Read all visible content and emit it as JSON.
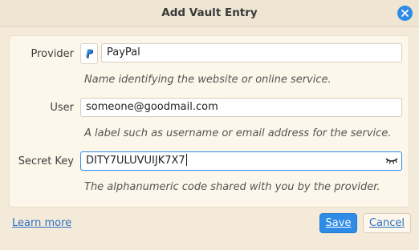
{
  "dialog": {
    "title": "Add Vault Entry"
  },
  "form": {
    "provider": {
      "label": "Provider",
      "value": "PayPal",
      "hint": "Name identifying the website or online service."
    },
    "user": {
      "label": "User",
      "value": "someone@goodmail.com",
      "hint": "A label such as username or email address for the service."
    },
    "secret": {
      "label": "Secret Key",
      "value": "DITY7ULUVUIJK7X7",
      "hint": "The alphanumeric code shared with you by the provider."
    }
  },
  "footer": {
    "learn_more": "Learn more",
    "save": "Save",
    "cancel": "Cancel"
  },
  "colors": {
    "accent": "#2e8be6",
    "link": "#2a6fc2",
    "background": "#f4ead9"
  },
  "icons": [
    "close-icon",
    "paypal-logo",
    "eye-closed-icon"
  ]
}
